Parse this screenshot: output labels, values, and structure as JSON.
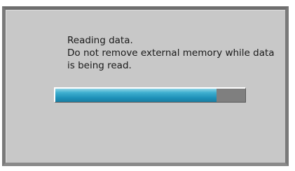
{
  "dialog": {
    "message_lines": [
      "Reading data.",
      "Do not remove external memory while data",
      "is being read."
    ]
  },
  "progress": {
    "fraction": 0.85,
    "fill_color": "#1e90b8",
    "track_color": "#7f7f7f"
  },
  "colors": {
    "dialog_background": "#c8c8c8",
    "dialog_border": "#6e6e6e"
  }
}
